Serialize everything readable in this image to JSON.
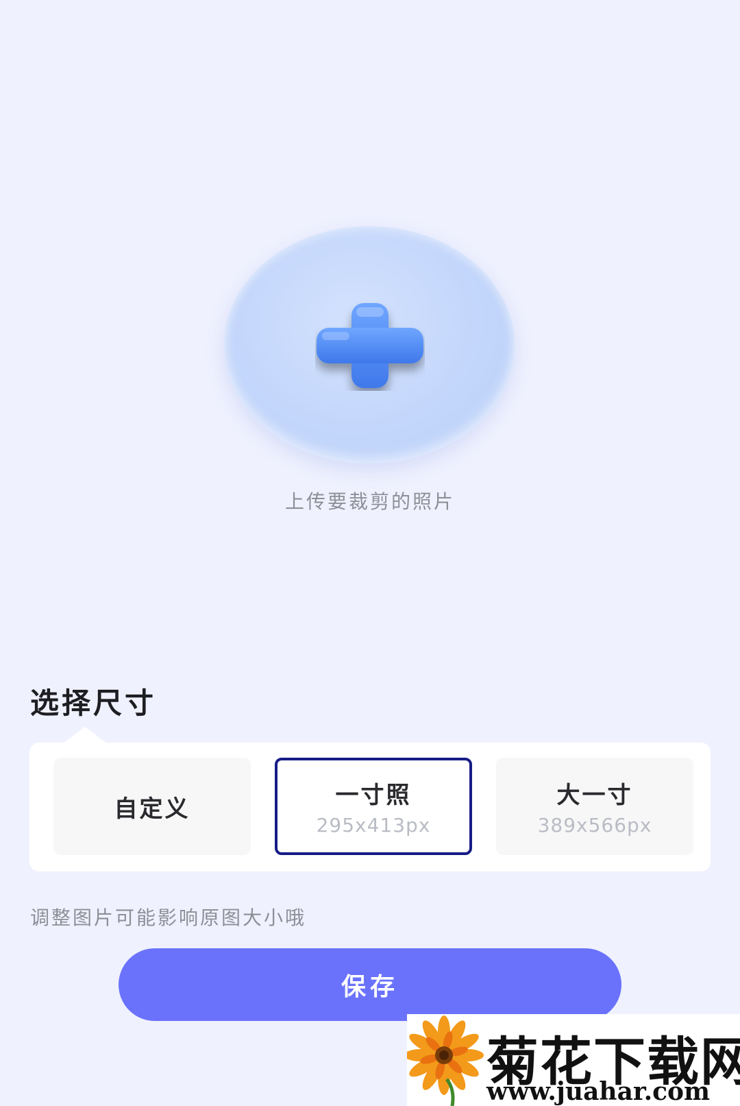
{
  "upload": {
    "hint": "上传要裁剪的照片",
    "icon": "plus-icon",
    "accent_color": "#4a86f0"
  },
  "size_section": {
    "title": "选择尺寸",
    "options": [
      {
        "label": "自定义",
        "dims": "",
        "selected": false
      },
      {
        "label": "一寸照",
        "dims": "295x413px",
        "selected": true
      },
      {
        "label": "大一寸",
        "dims": "389x566px",
        "selected": false
      }
    ],
    "selected_border_color": "#171c86"
  },
  "notice": "调整图片可能影响原图大小哦",
  "save_button": {
    "label": "保存",
    "color": "#6a72fb"
  },
  "watermark": {
    "title": "菊花下载网",
    "url": "www.juahar.com"
  }
}
